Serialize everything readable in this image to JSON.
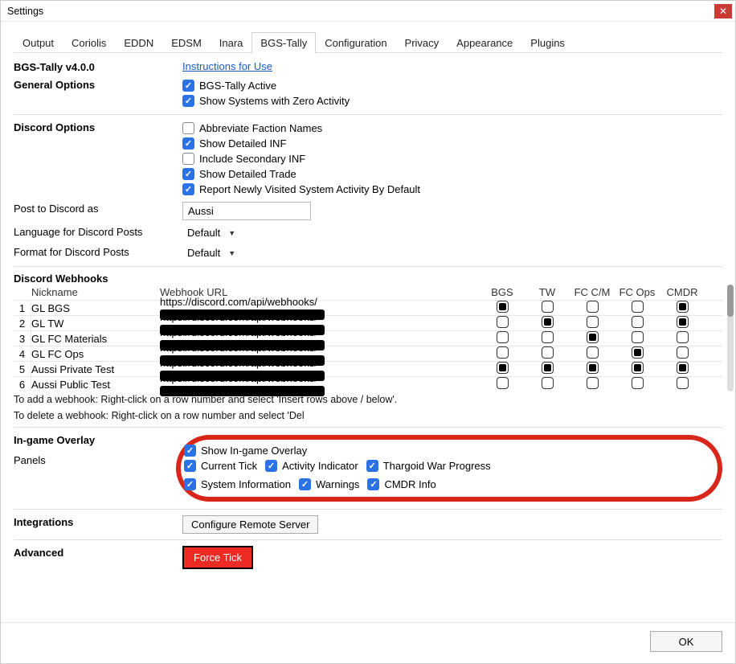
{
  "window": {
    "title": "Settings"
  },
  "tabs": [
    "Output",
    "Coriolis",
    "EDDN",
    "EDSM",
    "Inara",
    "BGS-Tally",
    "Configuration",
    "Privacy",
    "Appearance",
    "Plugins"
  ],
  "active_tab_index": 5,
  "header": {
    "version": "BGS-Tally v4.0.0",
    "instructions": "Instructions for Use"
  },
  "general": {
    "title": "General Options",
    "active_label": "BGS-Tally Active",
    "active_checked": true,
    "zero_label": "Show Systems with Zero Activity",
    "zero_checked": true
  },
  "discord": {
    "title": "Discord Options",
    "abbrev_label": "Abbreviate Faction Names",
    "abbrev_checked": false,
    "detailed_inf_label": "Show Detailed INF",
    "detailed_inf_checked": true,
    "secondary_inf_label": "Include Secondary INF",
    "secondary_inf_checked": false,
    "detailed_trade_label": "Show Detailed Trade",
    "detailed_trade_checked": true,
    "report_new_label": "Report Newly Visited System Activity By Default",
    "report_new_checked": true,
    "post_as_label": "Post to Discord as",
    "post_as_value": "Aussi",
    "lang_label": "Language for Discord Posts",
    "lang_value": "Default",
    "format_label": "Format for Discord Posts",
    "format_value": "Default"
  },
  "webhooks": {
    "title": "Discord Webhooks",
    "col_nick": "Nickname",
    "col_url": "Webhook URL",
    "cols": [
      "BGS",
      "TW",
      "FC C/M",
      "FC Ops",
      "CMDR"
    ],
    "rows": [
      {
        "n": "1",
        "nick": "GL BGS",
        "url": "https://discord.com/api/webhooks/",
        "flags": [
          true,
          false,
          false,
          false,
          true
        ]
      },
      {
        "n": "2",
        "nick": "GL TW",
        "url": "https://discord.com/api/webhooks/",
        "flags": [
          false,
          true,
          false,
          false,
          true
        ]
      },
      {
        "n": "3",
        "nick": "GL FC Materials",
        "url": "https://discord.com/api/webhooks/",
        "flags": [
          false,
          false,
          true,
          false,
          false
        ]
      },
      {
        "n": "4",
        "nick": "GL FC Ops",
        "url": "https://discord.com/api/webhooks/",
        "flags": [
          false,
          false,
          false,
          true,
          false
        ]
      },
      {
        "n": "5",
        "nick": "Aussi Private Test",
        "url": "https://discord.com/api/webhooks/",
        "flags": [
          true,
          true,
          true,
          true,
          true
        ]
      },
      {
        "n": "6",
        "nick": "Aussi Public Test",
        "url": "https://discord.com/api/webhooks/",
        "flags": [
          false,
          false,
          false,
          false,
          false
        ]
      }
    ],
    "hint_add": "To add a webhook: Right-click on a row number and select 'Insert rows above / below'.",
    "hint_del": "To delete a webhook: Right-click on a row number and select 'Del"
  },
  "overlay": {
    "title": "In-game Overlay",
    "show_label": "Show In-game Overlay",
    "show_checked": true,
    "panels_label": "Panels",
    "panels": [
      {
        "label": "Current Tick",
        "checked": true
      },
      {
        "label": "Activity Indicator",
        "checked": true
      },
      {
        "label": "Thargoid War Progress",
        "checked": true
      },
      {
        "label": "System Information",
        "checked": true
      },
      {
        "label": "Warnings",
        "checked": true
      },
      {
        "label": "CMDR Info",
        "checked": true
      }
    ]
  },
  "integrations": {
    "title": "Integrations",
    "button": "Configure Remote Server"
  },
  "advanced": {
    "title": "Advanced",
    "button": "Force Tick"
  },
  "footer": {
    "ok": "OK"
  }
}
